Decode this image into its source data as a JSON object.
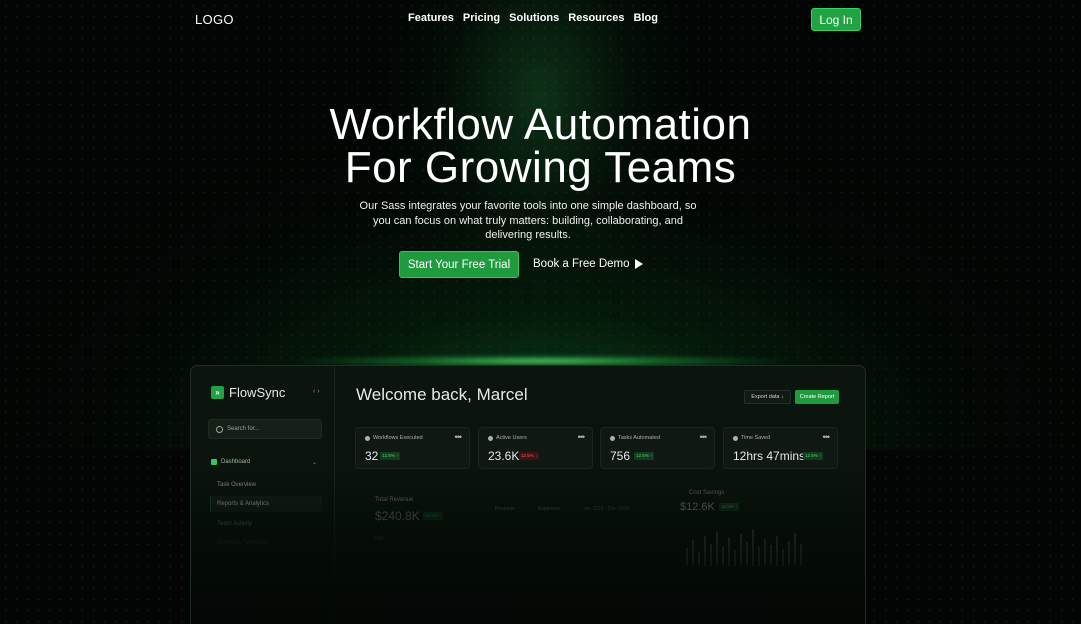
{
  "nav": {
    "logo": "LOGO",
    "links": [
      "Features",
      "Pricing",
      "Solutions",
      "Resources",
      "Blog"
    ],
    "login_label": "Log In"
  },
  "hero": {
    "title_line1": "Workflow Automation",
    "title_line2": "For Growing Teams",
    "subtitle_line1": "Our Sass integrates your favorite tools into one simple dashboard, so",
    "subtitle_line2": "you can focus on what truly matters: building, collaborating, and",
    "subtitle_line3": "delivering results.",
    "primary_cta": "Start Your Free Trial",
    "secondary_cta": "Book a Free Demo"
  },
  "dashboard": {
    "brand": "FlowSync",
    "brand_icon": "»",
    "collapse_icon": "‹ ›",
    "search_placeholder": "Search for...",
    "menu_dashboard": "Dashboard",
    "menu_chevron": "⌄",
    "submenu": [
      "Task Overview",
      "Reports & Analytics",
      "Team Activity",
      "Workflow Templates"
    ],
    "welcome": "Welcome back, Marcel",
    "export_label": "Export data ↓",
    "create_label": "Create Report",
    "kpis": [
      {
        "label": "Workflows Executed",
        "value": "32",
        "badge": "12.5% ↑",
        "trend": "up",
        "icon": "eye-icon"
      },
      {
        "label": "Active Users",
        "value": "23.6K",
        "badge": "12.5% ↓",
        "trend": "down",
        "icon": "user-icon"
      },
      {
        "label": "Tasks Automated",
        "value": "756",
        "badge": "12.5% ↑",
        "trend": "up",
        "icon": "gear-icon"
      },
      {
        "label": "Time Saved",
        "value": "12hrs 47mins",
        "badge": "12.5% ↑",
        "trend": "up",
        "icon": "star-icon"
      }
    ],
    "kpi_menu": "•••",
    "revenue": {
      "label": "Total Revenue",
      "value": "$240.8K",
      "badge": "12.5% ↑",
      "sub": "50K"
    },
    "legend": {
      "revenue": "Revenue",
      "expenses": "Expenses"
    },
    "date_range": "Jan 2024 - Dec 2024",
    "cost_savings": {
      "label": "Cost Savings",
      "value": "$12.6K",
      "badge": "12.5% ↑"
    },
    "colors": {
      "accent": "#1fa343",
      "background": "#020503",
      "panel": "#0b150e",
      "up": "#4fd775",
      "down": "#ef5a5a"
    }
  }
}
